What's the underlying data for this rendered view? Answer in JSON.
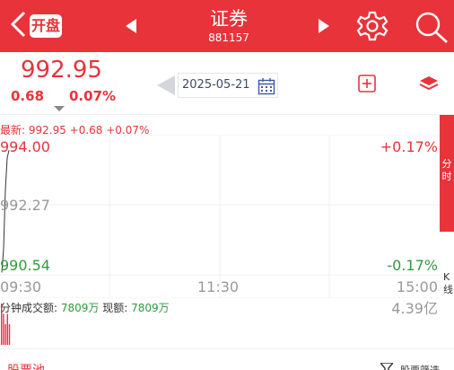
{
  "header": {
    "open_badge": "开盘",
    "title": "证券",
    "code": "881157",
    "colors": {
      "background": "#e8333a",
      "foreground": "#ffffff"
    },
    "icons": [
      "back-chevron-icon",
      "prev-arrow-icon",
      "next-arrow-icon",
      "gear-icon",
      "search-icon"
    ]
  },
  "quote": {
    "price": "992.95",
    "change_abs": "0.68",
    "change_pct": "0.07%",
    "up_color": "#e8333a",
    "down_color": "#2e9b3c"
  },
  "date_nav": {
    "date": "2025-05-21"
  },
  "latest_line": "最新: 992.95 +0.68 +0.07%",
  "chart": {
    "price_high": "994.00",
    "price_mid": "992.27",
    "price_low": "990.54",
    "pct_high": "+0.17%",
    "pct_low": "-0.17%",
    "time_start": "09:30",
    "time_mid": "11:30",
    "time_end": "15:00"
  },
  "side_tabs": {
    "active": [
      "分",
      "时"
    ],
    "k": [
      "K",
      "线"
    ]
  },
  "volume": {
    "label_prefix": "分钟成交额:",
    "value1": "7809万",
    "label_mid": "现额:",
    "value2": "7809万",
    "total": "4.39亿"
  },
  "footer": {
    "stock_pool": "股票池",
    "filter": "股票筛选"
  },
  "chart_data": {
    "type": "line",
    "x": [
      "09:30",
      "09:31",
      "09:32",
      "09:33",
      "09:34"
    ],
    "y": [
      990.6,
      991.2,
      992.7,
      993.5,
      993.7
    ],
    "ylim": [
      990.54,
      994.0
    ],
    "xlim_labels": [
      "09:30",
      "11:30",
      "15:00"
    ],
    "grid": true,
    "volume_values": [
      4,
      3,
      2,
      3,
      2
    ],
    "line_color": "#333333",
    "volume_color": "#e8333a"
  }
}
